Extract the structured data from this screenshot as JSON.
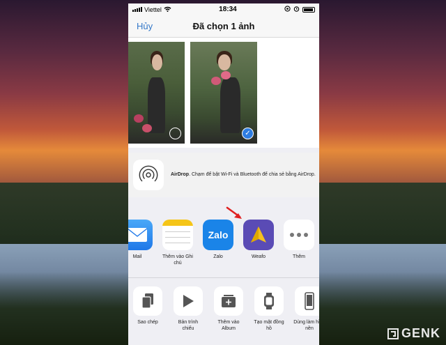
{
  "status_bar": {
    "carrier": "Viettel",
    "time": "18:34",
    "icons": [
      "signal-icon",
      "wifi-icon",
      "lock-rotation-icon",
      "alarm-icon",
      "battery-icon"
    ]
  },
  "nav": {
    "cancel_label": "Hủy",
    "title": "Đã chọn 1 ảnh"
  },
  "photos": [
    {
      "selected": false
    },
    {
      "selected": true
    }
  ],
  "airdrop": {
    "title": "AirDrop",
    "description": ". Chạm để bật Wi-Fi và Bluetooth để chia sẻ bằng AirDrop."
  },
  "apps": [
    {
      "label": "Mail",
      "icon": "mail-icon"
    },
    {
      "label": "Thêm vào Ghi chú",
      "icon": "notes-icon"
    },
    {
      "label": "Zalo",
      "icon": "zalo-icon",
      "icon_text": "Zalo"
    },
    {
      "label": "Weafo",
      "icon": "weafo-icon"
    },
    {
      "label": "Thêm",
      "icon": "more-icon"
    }
  ],
  "actions": [
    {
      "label": "Sao chép",
      "icon": "copy-icon"
    },
    {
      "label": "Bản trình chiếu",
      "icon": "play-icon"
    },
    {
      "label": "Thêm vào Album",
      "icon": "add-album-icon"
    },
    {
      "label": "Tạo mặt đồng hồ",
      "icon": "watch-icon"
    },
    {
      "label": "Dùng làm hình nền",
      "icon": "phone-icon"
    }
  ],
  "watermark": "GENK",
  "colors": {
    "accent": "#3478c8",
    "selection": "#2f7de1",
    "annotation_arrow": "#e02020"
  }
}
